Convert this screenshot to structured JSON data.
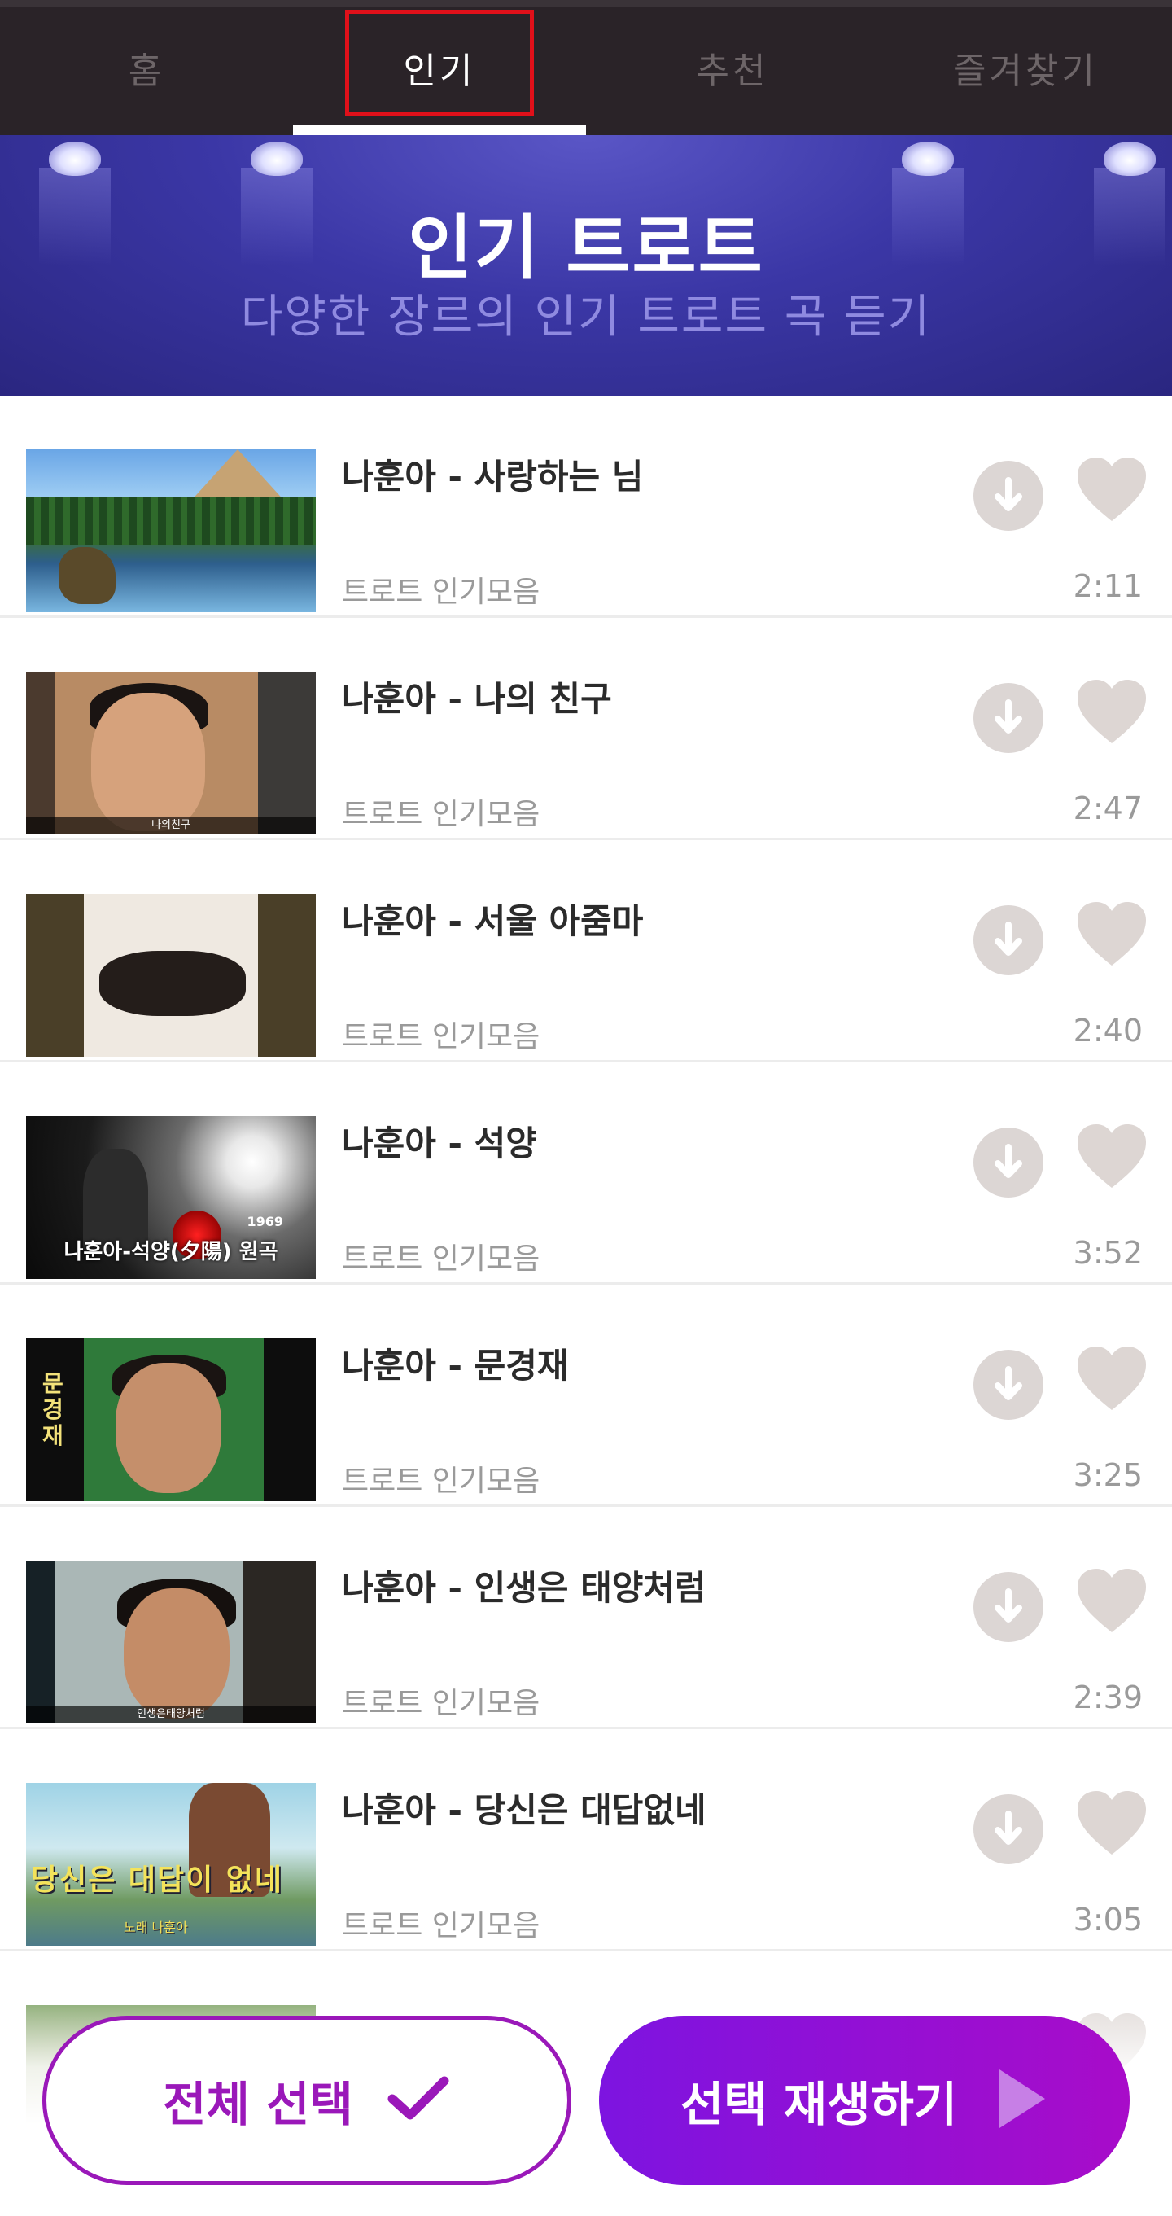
{
  "tabs": [
    {
      "label": "홈"
    },
    {
      "label": "인기"
    },
    {
      "label": "추천"
    },
    {
      "label": "즐겨찾기"
    }
  ],
  "banner": {
    "title": "인기 트로트",
    "subtitle": "다양한 장르의 인기 트로트 곡 듣기"
  },
  "songs": [
    {
      "title": "나훈아 - 사랑하는 님",
      "subtitle": "트로트 인기모음",
      "duration": "2:11"
    },
    {
      "title": "나훈아 - 나의 친구",
      "subtitle": "트로트 인기모음",
      "duration": "2:47",
      "thumb_caption": "나의친구"
    },
    {
      "title": "나훈아 - 서울 아줌마",
      "subtitle": "트로트 인기모음",
      "duration": "2:40"
    },
    {
      "title": "나훈아 - 석양",
      "subtitle": "트로트 인기모음",
      "duration": "3:52",
      "thumb_caption": "나훈아-석양(夕陽) 원곡",
      "thumb_year": "1969"
    },
    {
      "title": "나훈아 - 문경재",
      "subtitle": "트로트 인기모음",
      "duration": "3:25",
      "thumb_caption": "문경재"
    },
    {
      "title": "나훈아 - 인생은 태양처럼",
      "subtitle": "트로트 인기모음",
      "duration": "2:39",
      "thumb_caption": "인생은태양처럼"
    },
    {
      "title": "나훈아 - 당신은 대답없네",
      "subtitle": "트로트 인기모음",
      "duration": "3:05",
      "thumb_caption": "당신은 대답이 없네",
      "thumb_caption_small": "노래 나훈아"
    }
  ],
  "actions": {
    "select_all": "전체 선택",
    "play_selected": "선택 재생하기"
  },
  "colors": {
    "accent": "#9a18b9",
    "play_gradient_start": "#7d14e0",
    "play_gradient_end": "#a80cc9",
    "tab_bar": "#2a2328",
    "banner": "#3b37a6",
    "highlight_box": "#e0101a"
  },
  "icons": {
    "download": "download-circle-icon",
    "favorite": "heart-icon",
    "select_all": "check-icon",
    "play": "play-icon"
  }
}
